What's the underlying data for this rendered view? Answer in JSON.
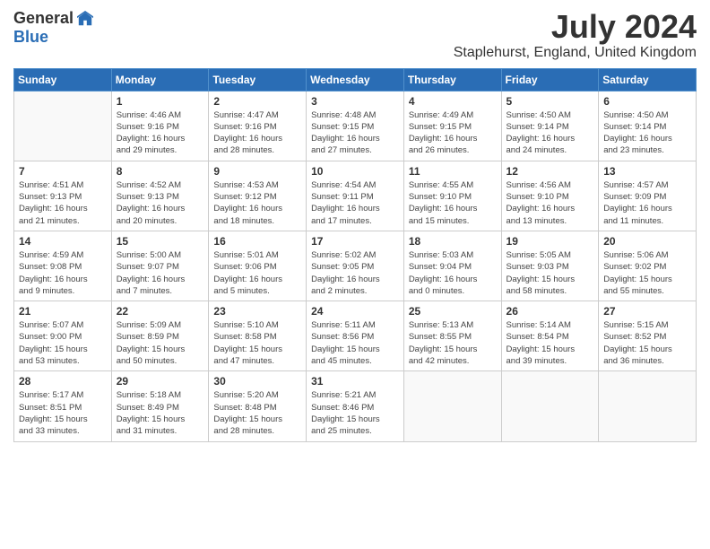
{
  "logo": {
    "general": "General",
    "blue": "Blue"
  },
  "title": "July 2024",
  "location": "Staplehurst, England, United Kingdom",
  "weekdays": [
    "Sunday",
    "Monday",
    "Tuesday",
    "Wednesday",
    "Thursday",
    "Friday",
    "Saturday"
  ],
  "weeks": [
    [
      {
        "day": "",
        "info": ""
      },
      {
        "day": "1",
        "info": "Sunrise: 4:46 AM\nSunset: 9:16 PM\nDaylight: 16 hours\nand 29 minutes."
      },
      {
        "day": "2",
        "info": "Sunrise: 4:47 AM\nSunset: 9:16 PM\nDaylight: 16 hours\nand 28 minutes."
      },
      {
        "day": "3",
        "info": "Sunrise: 4:48 AM\nSunset: 9:15 PM\nDaylight: 16 hours\nand 27 minutes."
      },
      {
        "day": "4",
        "info": "Sunrise: 4:49 AM\nSunset: 9:15 PM\nDaylight: 16 hours\nand 26 minutes."
      },
      {
        "day": "5",
        "info": "Sunrise: 4:50 AM\nSunset: 9:14 PM\nDaylight: 16 hours\nand 24 minutes."
      },
      {
        "day": "6",
        "info": "Sunrise: 4:50 AM\nSunset: 9:14 PM\nDaylight: 16 hours\nand 23 minutes."
      }
    ],
    [
      {
        "day": "7",
        "info": "Sunrise: 4:51 AM\nSunset: 9:13 PM\nDaylight: 16 hours\nand 21 minutes."
      },
      {
        "day": "8",
        "info": "Sunrise: 4:52 AM\nSunset: 9:13 PM\nDaylight: 16 hours\nand 20 minutes."
      },
      {
        "day": "9",
        "info": "Sunrise: 4:53 AM\nSunset: 9:12 PM\nDaylight: 16 hours\nand 18 minutes."
      },
      {
        "day": "10",
        "info": "Sunrise: 4:54 AM\nSunset: 9:11 PM\nDaylight: 16 hours\nand 17 minutes."
      },
      {
        "day": "11",
        "info": "Sunrise: 4:55 AM\nSunset: 9:10 PM\nDaylight: 16 hours\nand 15 minutes."
      },
      {
        "day": "12",
        "info": "Sunrise: 4:56 AM\nSunset: 9:10 PM\nDaylight: 16 hours\nand 13 minutes."
      },
      {
        "day": "13",
        "info": "Sunrise: 4:57 AM\nSunset: 9:09 PM\nDaylight: 16 hours\nand 11 minutes."
      }
    ],
    [
      {
        "day": "14",
        "info": "Sunrise: 4:59 AM\nSunset: 9:08 PM\nDaylight: 16 hours\nand 9 minutes."
      },
      {
        "day": "15",
        "info": "Sunrise: 5:00 AM\nSunset: 9:07 PM\nDaylight: 16 hours\nand 7 minutes."
      },
      {
        "day": "16",
        "info": "Sunrise: 5:01 AM\nSunset: 9:06 PM\nDaylight: 16 hours\nand 5 minutes."
      },
      {
        "day": "17",
        "info": "Sunrise: 5:02 AM\nSunset: 9:05 PM\nDaylight: 16 hours\nand 2 minutes."
      },
      {
        "day": "18",
        "info": "Sunrise: 5:03 AM\nSunset: 9:04 PM\nDaylight: 16 hours\nand 0 minutes."
      },
      {
        "day": "19",
        "info": "Sunrise: 5:05 AM\nSunset: 9:03 PM\nDaylight: 15 hours\nand 58 minutes."
      },
      {
        "day": "20",
        "info": "Sunrise: 5:06 AM\nSunset: 9:02 PM\nDaylight: 15 hours\nand 55 minutes."
      }
    ],
    [
      {
        "day": "21",
        "info": "Sunrise: 5:07 AM\nSunset: 9:00 PM\nDaylight: 15 hours\nand 53 minutes."
      },
      {
        "day": "22",
        "info": "Sunrise: 5:09 AM\nSunset: 8:59 PM\nDaylight: 15 hours\nand 50 minutes."
      },
      {
        "day": "23",
        "info": "Sunrise: 5:10 AM\nSunset: 8:58 PM\nDaylight: 15 hours\nand 47 minutes."
      },
      {
        "day": "24",
        "info": "Sunrise: 5:11 AM\nSunset: 8:56 PM\nDaylight: 15 hours\nand 45 minutes."
      },
      {
        "day": "25",
        "info": "Sunrise: 5:13 AM\nSunset: 8:55 PM\nDaylight: 15 hours\nand 42 minutes."
      },
      {
        "day": "26",
        "info": "Sunrise: 5:14 AM\nSunset: 8:54 PM\nDaylight: 15 hours\nand 39 minutes."
      },
      {
        "day": "27",
        "info": "Sunrise: 5:15 AM\nSunset: 8:52 PM\nDaylight: 15 hours\nand 36 minutes."
      }
    ],
    [
      {
        "day": "28",
        "info": "Sunrise: 5:17 AM\nSunset: 8:51 PM\nDaylight: 15 hours\nand 33 minutes."
      },
      {
        "day": "29",
        "info": "Sunrise: 5:18 AM\nSunset: 8:49 PM\nDaylight: 15 hours\nand 31 minutes."
      },
      {
        "day": "30",
        "info": "Sunrise: 5:20 AM\nSunset: 8:48 PM\nDaylight: 15 hours\nand 28 minutes."
      },
      {
        "day": "31",
        "info": "Sunrise: 5:21 AM\nSunset: 8:46 PM\nDaylight: 15 hours\nand 25 minutes."
      },
      {
        "day": "",
        "info": ""
      },
      {
        "day": "",
        "info": ""
      },
      {
        "day": "",
        "info": ""
      }
    ]
  ]
}
